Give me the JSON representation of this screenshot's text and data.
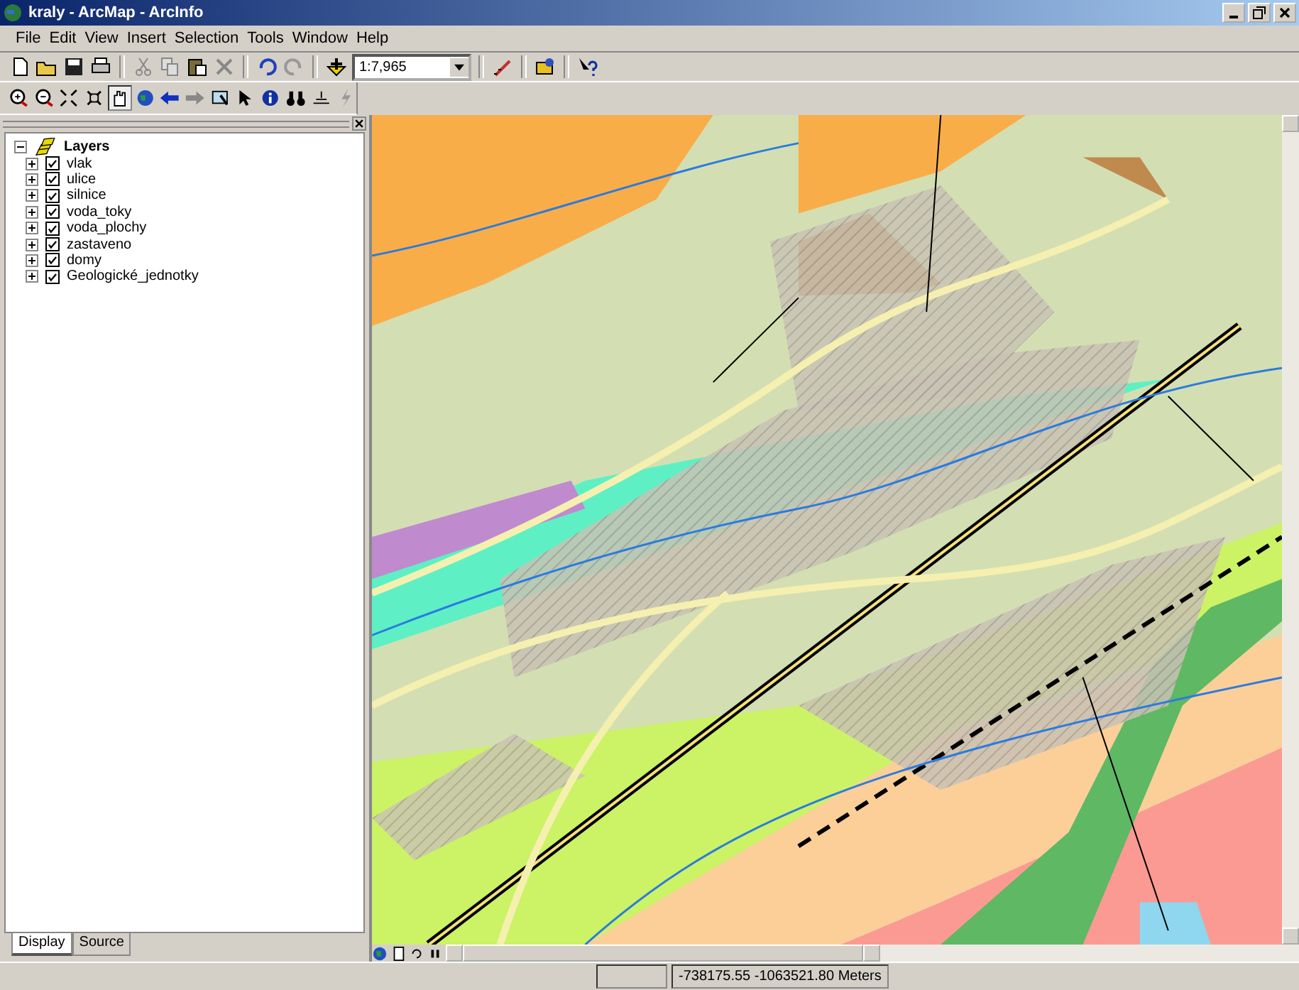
{
  "window": {
    "title": "kraly - ArcMap - ArcInfo"
  },
  "menu": [
    "File",
    "Edit",
    "View",
    "Insert",
    "Selection",
    "Tools",
    "Window",
    "Help"
  ],
  "scale": {
    "value": "1:7,965"
  },
  "toc": {
    "root": {
      "label": "Layers",
      "expanded": true
    },
    "layers": [
      {
        "label": "vlak",
        "checked": true,
        "expanded": false
      },
      {
        "label": "ulice",
        "checked": true,
        "expanded": false
      },
      {
        "label": "silnice",
        "checked": true,
        "expanded": false
      },
      {
        "label": "voda_toky",
        "checked": true,
        "expanded": false
      },
      {
        "label": "voda_plochy",
        "checked": true,
        "expanded": false
      },
      {
        "label": "zastaveno",
        "checked": true,
        "expanded": false
      },
      {
        "label": "domy",
        "checked": true,
        "expanded": false
      },
      {
        "label": "Geologické_jednotky",
        "checked": true,
        "expanded": false
      }
    ],
    "tabs": [
      {
        "label": "Display",
        "selected": true
      },
      {
        "label": "Source",
        "selected": false
      }
    ]
  },
  "status_bar": {
    "coordinates": "-738175.55  -1063521.80 Meters"
  }
}
